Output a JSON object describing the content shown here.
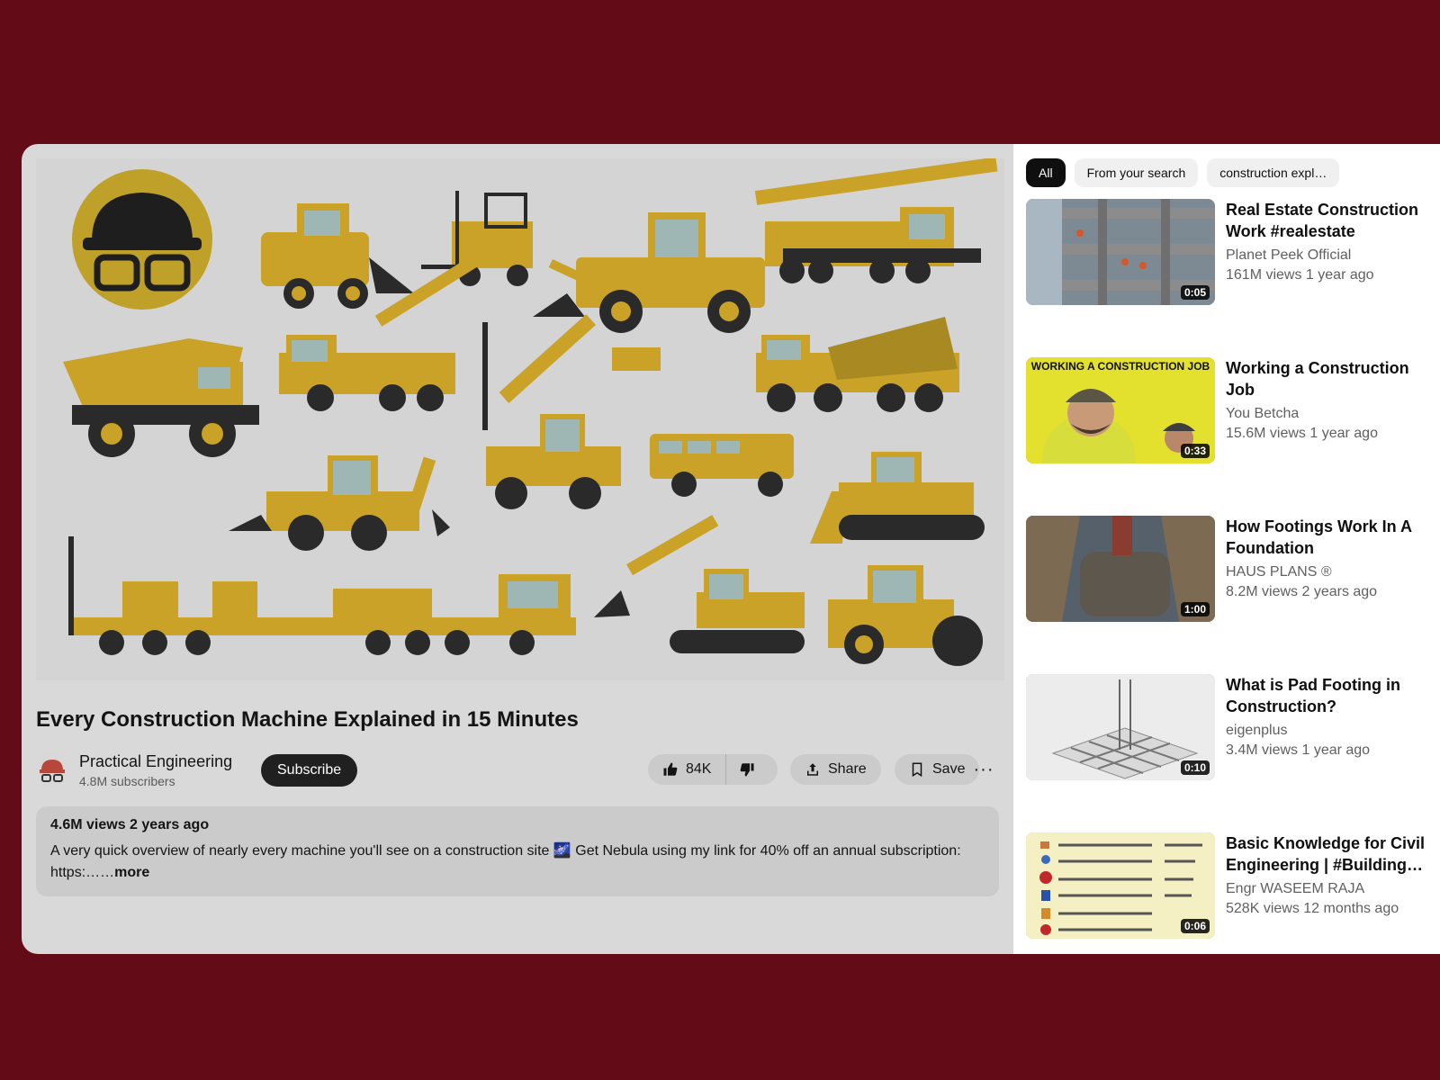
{
  "video": {
    "title": "Every Construction Machine Explained in 15 Minutes",
    "channel": {
      "name": "Practical Engineering",
      "subscribers": "4.8M subscribers"
    },
    "subscribe_label": "Subscribe",
    "actions": {
      "likes": "84K",
      "share": "Share",
      "save": "Save",
      "more": "···"
    },
    "description": {
      "meta": "4.6M views 2 years ago",
      "text": "A very quick overview of nearly every machine you'll see on a construction site 🌌 Get Nebula using my link for 40% off an annual subscription: https:……",
      "more": "more"
    }
  },
  "sidebar": {
    "chips": [
      "All",
      "From your search",
      "construction expl…"
    ],
    "videos": [
      {
        "title": "Real Estate Construction Work #realestate",
        "channel": "Planet Peek Official",
        "meta": "161M views 1 year ago",
        "duration": "0:05"
      },
      {
        "title": "Working a Construction Job",
        "channel": "You Betcha",
        "meta": "15.6M views 1 year ago",
        "duration": "0:33",
        "thumb_text": "WORKING A CONSTRUCTION JOB"
      },
      {
        "title": "How Footings Work In A Foundation",
        "channel": "HAUS PLANS ®",
        "meta": "8.2M views 2 years ago",
        "duration": "1:00"
      },
      {
        "title": "What is Pad Footing in Construction?",
        "channel": "eigenplus",
        "meta": "3.4M views 1 year ago",
        "duration": "0:10"
      },
      {
        "title": "Basic Knowledge for Civil Engineering | #Building…",
        "channel": "Engr WASEEM RAJA",
        "meta": "528K views 12 months ago",
        "duration": "0:06"
      }
    ]
  },
  "colors": {
    "page_bg": "#630b17",
    "machine_yellow": "#c9a227",
    "dark": "#2a2a2a"
  }
}
